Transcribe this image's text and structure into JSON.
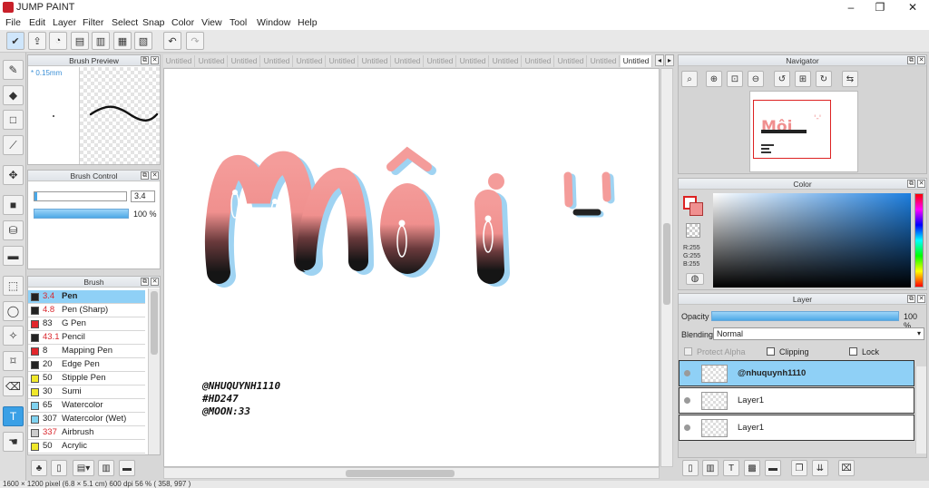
{
  "app": {
    "title": "JUMP PAINT"
  },
  "menu": [
    "File",
    "Edit",
    "Layer",
    "Filter",
    "Select",
    "Snap",
    "Color",
    "View",
    "Tool",
    "Window",
    "Help"
  ],
  "panels": {
    "brush_preview": {
      "title": "Brush Preview",
      "size_label": "* 0.15mm"
    },
    "brush_control": {
      "title": "Brush Control",
      "size_value": "3.4",
      "opacity_value": "100 %"
    },
    "brush": {
      "title": "Brush",
      "items": [
        {
          "size": "3.4",
          "name": "Pen",
          "color": "#222222",
          "size_color": "#d9262c",
          "selected": true
        },
        {
          "size": "4.8",
          "name": "Pen (Sharp)",
          "color": "#222222",
          "size_color": "#d9262c"
        },
        {
          "size": "83",
          "name": "G Pen",
          "color": "#e2262c",
          "size_color": "#222222"
        },
        {
          "size": "43.1",
          "name": "Pencil",
          "color": "#222222",
          "size_color": "#d9262c"
        },
        {
          "size": "8",
          "name": "Mapping Pen",
          "color": "#e2262c",
          "size_color": "#222222"
        },
        {
          "size": "20",
          "name": "Edge Pen",
          "color": "#222222",
          "size_color": "#222222"
        },
        {
          "size": "50",
          "name": "Stipple Pen",
          "color": "#f0e82a",
          "size_color": "#222222"
        },
        {
          "size": "30",
          "name": "Sumi",
          "color": "#f0e82a",
          "size_color": "#222222"
        },
        {
          "size": "65",
          "name": "Watercolor",
          "color": "#7fd2f0",
          "size_color": "#222222"
        },
        {
          "size": "307",
          "name": "Watercolor (Wet)",
          "color": "#7fd2f0",
          "size_color": "#222222"
        },
        {
          "size": "337",
          "name": "Airbrush",
          "color": "#cccccc",
          "size_color": "#d9262c"
        },
        {
          "size": "50",
          "name": "Acrylic",
          "color": "#f0e82a",
          "size_color": "#222222"
        }
      ]
    },
    "navigator": {
      "title": "Navigator"
    },
    "color": {
      "title": "Color",
      "r": "R:255",
      "g": "G:255",
      "b": "B:255"
    },
    "layer": {
      "title": "Layer",
      "opacity_label": "Opacity",
      "opacity_value": "100 %",
      "blending_label": "Blending",
      "blending_value": "Normal",
      "protect_alpha": "Protect Alpha",
      "clipping": "Clipping",
      "lock": "Lock",
      "layers": [
        {
          "name": "@nhuquynh1110",
          "selected": true
        },
        {
          "name": "Layer1"
        },
        {
          "name": "Layer1"
        }
      ]
    }
  },
  "tabs": [
    "Untitled",
    "Untitled",
    "Untitled",
    "Untitled",
    "Untitled",
    "Untitled",
    "Untitled",
    "Untitled",
    "Untitled",
    "Untitled",
    "Untitled",
    "Untitled",
    "Untitled",
    "Untitled",
    "Untitled"
  ],
  "artwork": {
    "title_text": "Môi",
    "face_text": "'-'",
    "signature": [
      "@NHUQUYNH1110",
      "#HD247",
      "@MOON:33"
    ]
  },
  "status": "1600 × 1200 pixel  (6.8 × 5.1 cm)  600 dpi  56 %  ( 358, 997 )",
  "colors": {
    "accent": "#3aa0e6",
    "selection": "#8fd0f6",
    "pink": "#f08f8f",
    "shadow": "#9fd3f2"
  }
}
